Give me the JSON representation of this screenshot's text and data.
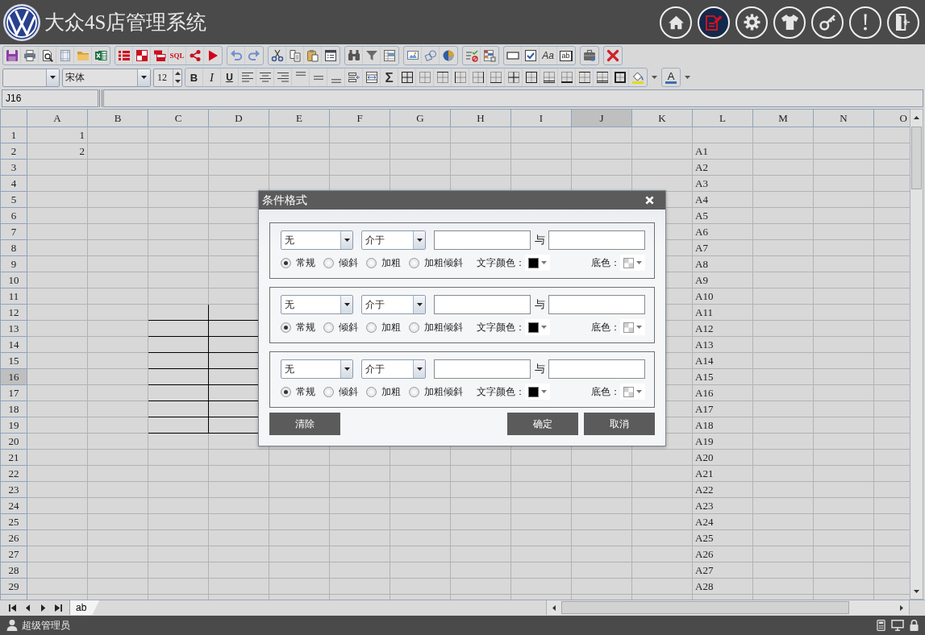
{
  "header": {
    "title": "大众4S店管理系统",
    "nav_buttons": [
      {
        "selected": false
      },
      {
        "selected": true
      },
      {
        "selected": false
      },
      {
        "selected": false
      },
      {
        "selected": false
      },
      {
        "selected": false
      },
      {
        "selected": false
      }
    ]
  },
  "toolbar": {
    "sql_button": "SQL",
    "font_style_button": "Aa",
    "text_field_button": "ab"
  },
  "format_bar": {
    "font": "宋体",
    "font_size": "12",
    "bold_button": "B",
    "italic_button": "I",
    "underline_button": "U",
    "sum_button": "Σ",
    "font_color_button": "A"
  },
  "formula_bar": {
    "cell_name": "J16"
  },
  "sheet": {
    "columns": [
      {
        "label": "A",
        "selected": false
      },
      {
        "label": "B",
        "selected": false
      },
      {
        "label": "C",
        "selected": false
      },
      {
        "label": "D",
        "selected": false
      },
      {
        "label": "E",
        "selected": false
      },
      {
        "label": "F",
        "selected": false
      },
      {
        "label": "G",
        "selected": false
      },
      {
        "label": "H",
        "selected": false
      },
      {
        "label": "I",
        "selected": false
      },
      {
        "label": "J",
        "selected": true
      },
      {
        "label": "K",
        "selected": false
      },
      {
        "label": "L",
        "selected": false
      },
      {
        "label": "M",
        "selected": false
      },
      {
        "label": "N",
        "selected": false
      },
      {
        "label": "O",
        "selected": false
      }
    ],
    "rows": [
      {
        "label": "1",
        "selected": false,
        "boxed": false,
        "cell_a": "1"
      },
      {
        "label": "2",
        "selected": false,
        "boxed": false,
        "cell_a": "2",
        "cell_l": "A1"
      },
      {
        "label": "3",
        "selected": false,
        "boxed": false,
        "cell_l": "A2"
      },
      {
        "label": "4",
        "selected": false,
        "boxed": false,
        "cell_l": "A3"
      },
      {
        "label": "5",
        "selected": false,
        "boxed": false,
        "cell_l": "A4"
      },
      {
        "label": "6",
        "selected": false,
        "boxed": false,
        "cell_l": "A5"
      },
      {
        "label": "7",
        "selected": false,
        "boxed": false,
        "cell_l": "A6"
      },
      {
        "label": "8",
        "selected": false,
        "boxed": false,
        "cell_l": "A7"
      },
      {
        "label": "9",
        "selected": false,
        "boxed": false,
        "cell_l": "A8"
      },
      {
        "label": "10",
        "selected": false,
        "boxed": false,
        "cell_l": "A9"
      },
      {
        "label": "11",
        "selected": false,
        "boxed": false,
        "cell_l": "A10"
      },
      {
        "label": "12",
        "selected": false,
        "boxed": true,
        "cell_l": "A11"
      },
      {
        "label": "13",
        "selected": false,
        "boxed": true,
        "cell_l": "A12"
      },
      {
        "label": "14",
        "selected": false,
        "boxed": true,
        "cell_l": "A13"
      },
      {
        "label": "15",
        "selected": false,
        "boxed": true,
        "cell_l": "A14"
      },
      {
        "label": "16",
        "selected": true,
        "boxed": true,
        "cell_l": "A15"
      },
      {
        "label": "17",
        "selected": false,
        "boxed": true,
        "cell_l": "A16"
      },
      {
        "label": "18",
        "selected": false,
        "boxed": true,
        "cell_l": "A17"
      },
      {
        "label": "19",
        "selected": false,
        "boxed": true,
        "cell_l": "A18"
      },
      {
        "label": "20",
        "selected": false,
        "boxed": false,
        "cell_l": "A19"
      },
      {
        "label": "21",
        "selected": false,
        "boxed": false,
        "cell_l": "A20"
      },
      {
        "label": "22",
        "selected": false,
        "boxed": false,
        "cell_l": "A21"
      },
      {
        "label": "23",
        "selected": false,
        "boxed": false,
        "cell_l": "A22"
      },
      {
        "label": "24",
        "selected": false,
        "boxed": false,
        "cell_l": "A23"
      },
      {
        "label": "25",
        "selected": false,
        "boxed": false,
        "cell_l": "A24"
      },
      {
        "label": "26",
        "selected": false,
        "boxed": false,
        "cell_l": "A25"
      },
      {
        "label": "27",
        "selected": false,
        "boxed": false,
        "cell_l": "A26"
      },
      {
        "label": "28",
        "selected": false,
        "boxed": false,
        "cell_l": "A27"
      },
      {
        "label": "29",
        "selected": false,
        "boxed": false,
        "cell_l": "A28"
      }
    ]
  },
  "dialog": {
    "title": "条件格式",
    "conditions": [
      {
        "field": "无",
        "operator": "介于",
        "and_label": "与",
        "styles": [
          {
            "label": "常规",
            "selected": true
          },
          {
            "label": "倾斜",
            "selected": false
          },
          {
            "label": "加粗",
            "selected": false
          },
          {
            "label": "加粗倾斜",
            "selected": false
          }
        ],
        "text_color_label": "文字颜色：",
        "background_label": "底色："
      },
      {
        "field": "无",
        "operator": "介于",
        "and_label": "与",
        "styles": [
          {
            "label": "常规",
            "selected": true
          },
          {
            "label": "倾斜",
            "selected": false
          },
          {
            "label": "加粗",
            "selected": false
          },
          {
            "label": "加粗倾斜",
            "selected": false
          }
        ],
        "text_color_label": "文字颜色：",
        "background_label": "底色："
      },
      {
        "field": "无",
        "operator": "介于",
        "and_label": "与",
        "styles": [
          {
            "label": "常规",
            "selected": true
          },
          {
            "label": "倾斜",
            "selected": false
          },
          {
            "label": "加粗",
            "selected": false
          },
          {
            "label": "加粗倾斜",
            "selected": false
          }
        ],
        "text_color_label": "文字颜色：",
        "background_label": "底色："
      }
    ],
    "clear_button": "清除",
    "ok_button": "确定",
    "cancel_button": "取消"
  },
  "sheet_tabs": [
    {
      "label": "ab",
      "selected": true
    }
  ],
  "status_bar": {
    "user": "超级管理员"
  }
}
